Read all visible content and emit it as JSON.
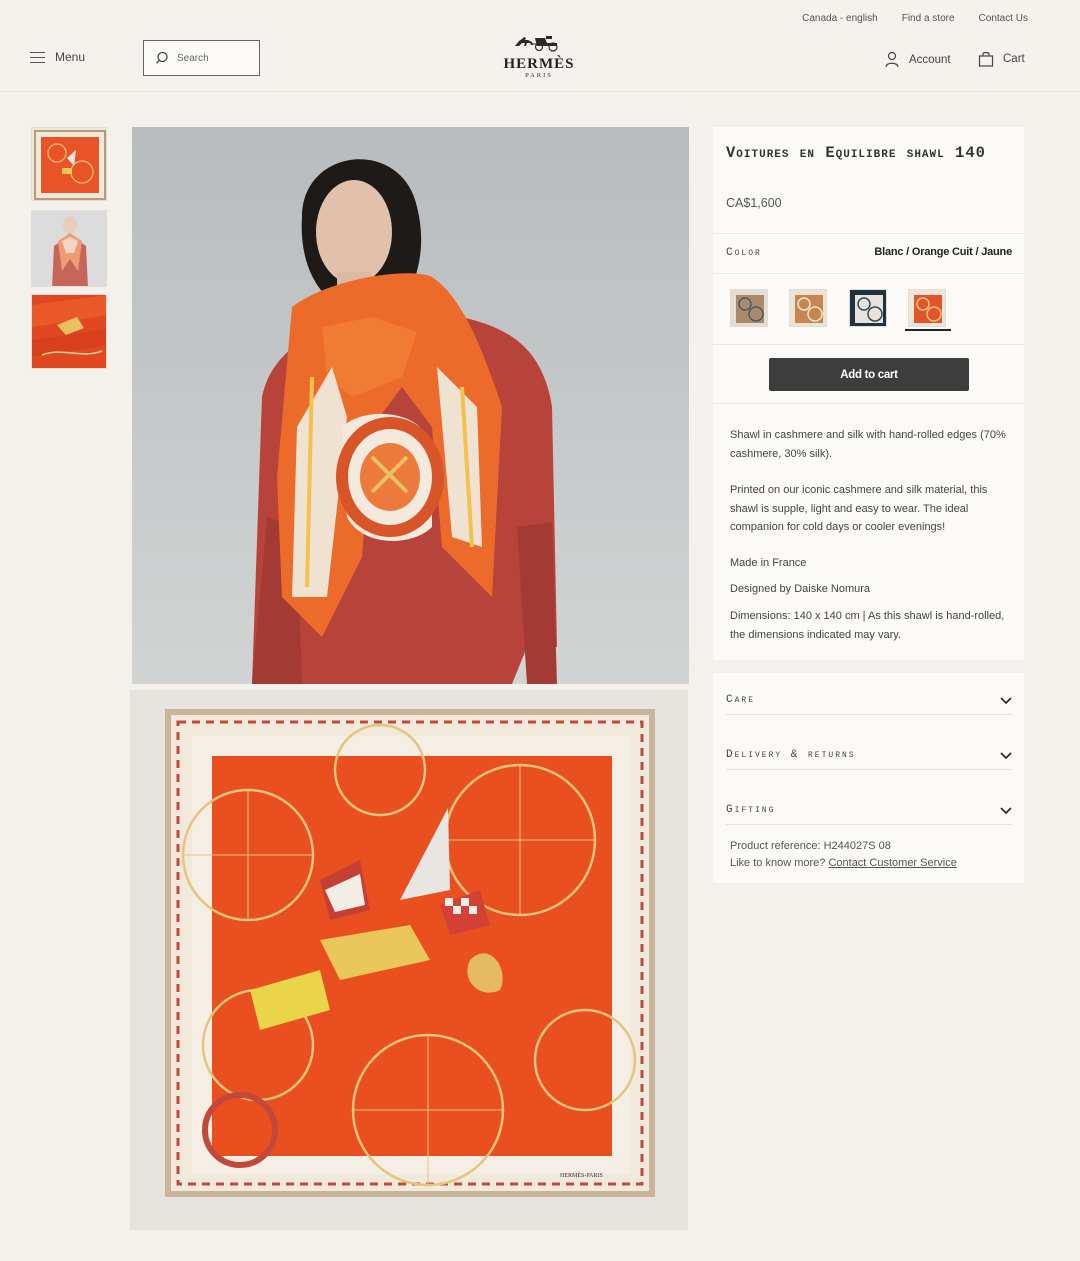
{
  "utility": {
    "locale": "Canada - english",
    "find_store": "Find a store",
    "contact": "Contact Us"
  },
  "header": {
    "menu_label": "Menu",
    "search_placeholder": "Search",
    "brand": "HERMÈS",
    "brand_city": "PARIS",
    "account_label": "Account",
    "cart_label": "Cart"
  },
  "product": {
    "title": "Voitures en Equilibre shawl 140",
    "price": "CA$1,600",
    "color_label": "Color",
    "color_value": "Blanc / Orange Cuit / Jaune",
    "swatches": [
      {
        "name": "swatch-1",
        "color": "#b7916e"
      },
      {
        "name": "swatch-2",
        "color": "#c58652"
      },
      {
        "name": "swatch-3",
        "color": "#2f4b5c"
      },
      {
        "name": "swatch-4",
        "color": "#e2552a",
        "selected": true
      }
    ],
    "add_to_cart": "Add to cart",
    "description": [
      "Shawl in cashmere and silk with hand-rolled edges (70% cashmere, 30% silk).",
      "Printed on our iconic cashmere and silk material, this shawl is supple, light and easy to wear. The ideal companion for cold days or cooler evenings!",
      "Made in France",
      "Designed by Daiske Nomura",
      "Dimensions: 140 x 140 cm | As this shawl is hand-rolled, the dimensions indicated may vary."
    ]
  },
  "accordion": [
    {
      "label": "Care"
    },
    {
      "label": "Delivery & returns"
    },
    {
      "label": "Gifting"
    }
  ],
  "reference": {
    "label": "Product reference:",
    "value": "H244027S 08",
    "help_prefix": "Like to know more?",
    "help_link": "Contact Customer Service"
  },
  "colors": {
    "scarf_orange": "#ea4f1f",
    "scarf_cream": "#f1e9dc",
    "button_dark": "#3d3d3d",
    "page_bg": "#f4f1ec"
  }
}
